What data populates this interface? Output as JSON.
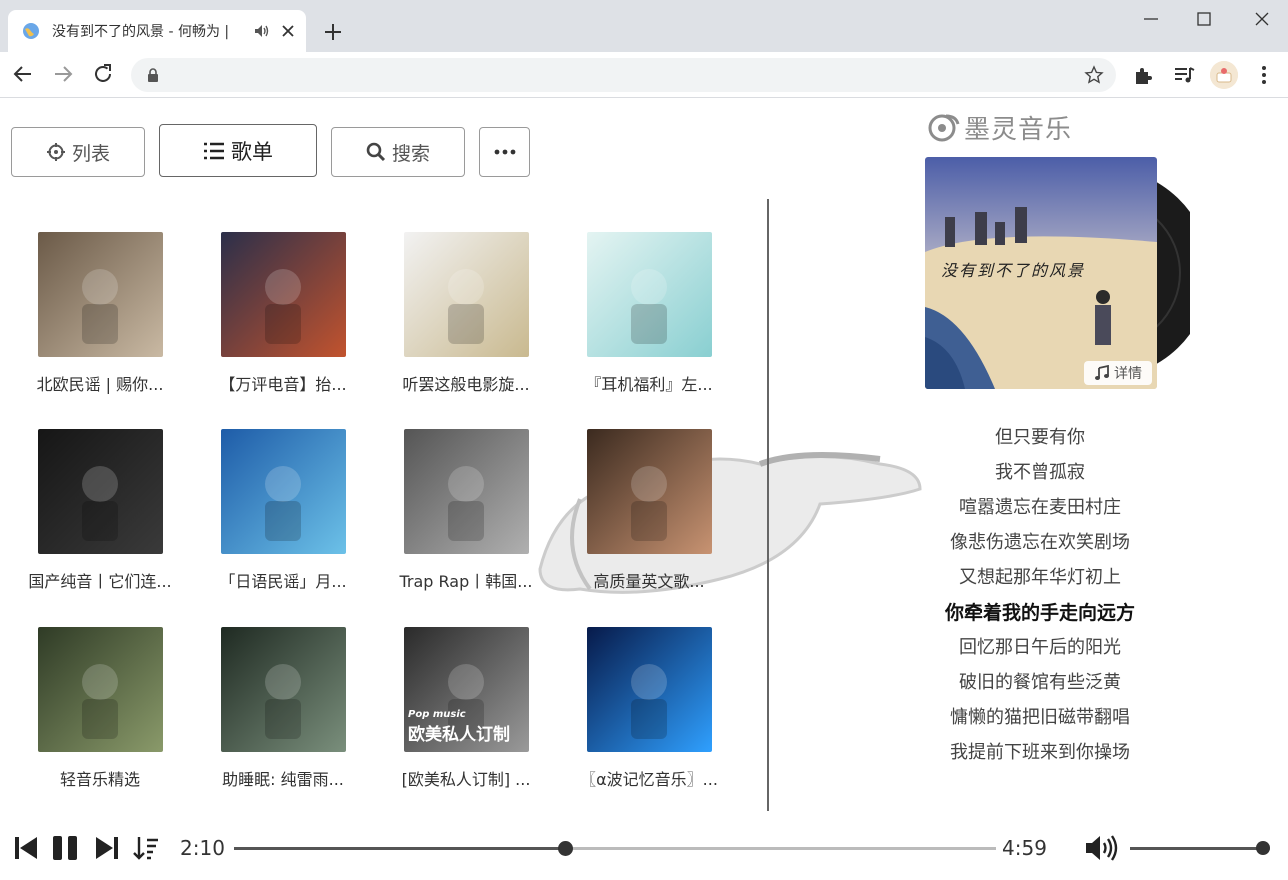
{
  "browser": {
    "tab_title": "没有到不了的风景 - 何畅为 |",
    "url": ""
  },
  "toolbar": {
    "list_label": "列表",
    "playlist_label": "歌单",
    "search_label": "搜索"
  },
  "logo_text": "墨灵音乐",
  "playlists": [
    {
      "title": "北欧民谣 | 赐你...",
      "colors": [
        "#6b5a48",
        "#c9b9a3"
      ]
    },
    {
      "title": "【万评电音】抬...",
      "colors": [
        "#2b2f4a",
        "#c2532e"
      ]
    },
    {
      "title": "听罢这般电影旋...",
      "colors": [
        "#f2f2f2",
        "#c9b98f"
      ]
    },
    {
      "title": "『耳机福利』左...",
      "colors": [
        "#e4f4f2",
        "#89cfd1"
      ]
    },
    {
      "title": "国产纯音丨它们连...",
      "colors": [
        "#161616",
        "#3a3a3a"
      ]
    },
    {
      "title": "「日语民谣」月...",
      "colors": [
        "#1e5ca8",
        "#6cc1e8"
      ]
    },
    {
      "title": "Trap Rap丨韩国...",
      "colors": [
        "#555555",
        "#b0b0b0"
      ]
    },
    {
      "title": "高质量英文歌...",
      "colors": [
        "#3b2a1f",
        "#c89372"
      ]
    },
    {
      "title": "轻音乐精选",
      "colors": [
        "#2f3b26",
        "#8a9a6a"
      ]
    },
    {
      "title": "助睡眠: 纯雷雨...",
      "colors": [
        "#1f2a22",
        "#7a8f7c"
      ]
    },
    {
      "title": "[欧美私人订制] ...",
      "colors": [
        "#2a2a2a",
        "#9a9a9a"
      ],
      "overlay_small": "Pop music",
      "overlay_big": "欧美私人订制"
    },
    {
      "title": "〖α波记忆音乐〗...",
      "colors": [
        "#071a4a",
        "#2fa0ff"
      ]
    }
  ],
  "album": {
    "art_title": "没有到不了的风景",
    "detail_label": "详情"
  },
  "lyrics": [
    "但只要有你",
    "我不曾孤寂",
    "喧嚣遗忘在麦田村庄",
    "像悲伤遗忘在欢笑剧场",
    "又想起那年华灯初上",
    "你牵着我的手走向远方",
    "回忆那日午后的阳光",
    "破旧的餐馆有些泛黄",
    "慵懒的猫把旧磁带翻唱",
    "我提前下班来到你操场"
  ],
  "current_lyric_index": 5,
  "player": {
    "current_time": "2:10",
    "total_time": "4:59",
    "progress_fraction": 0.434,
    "volume_fraction": 0.95
  }
}
